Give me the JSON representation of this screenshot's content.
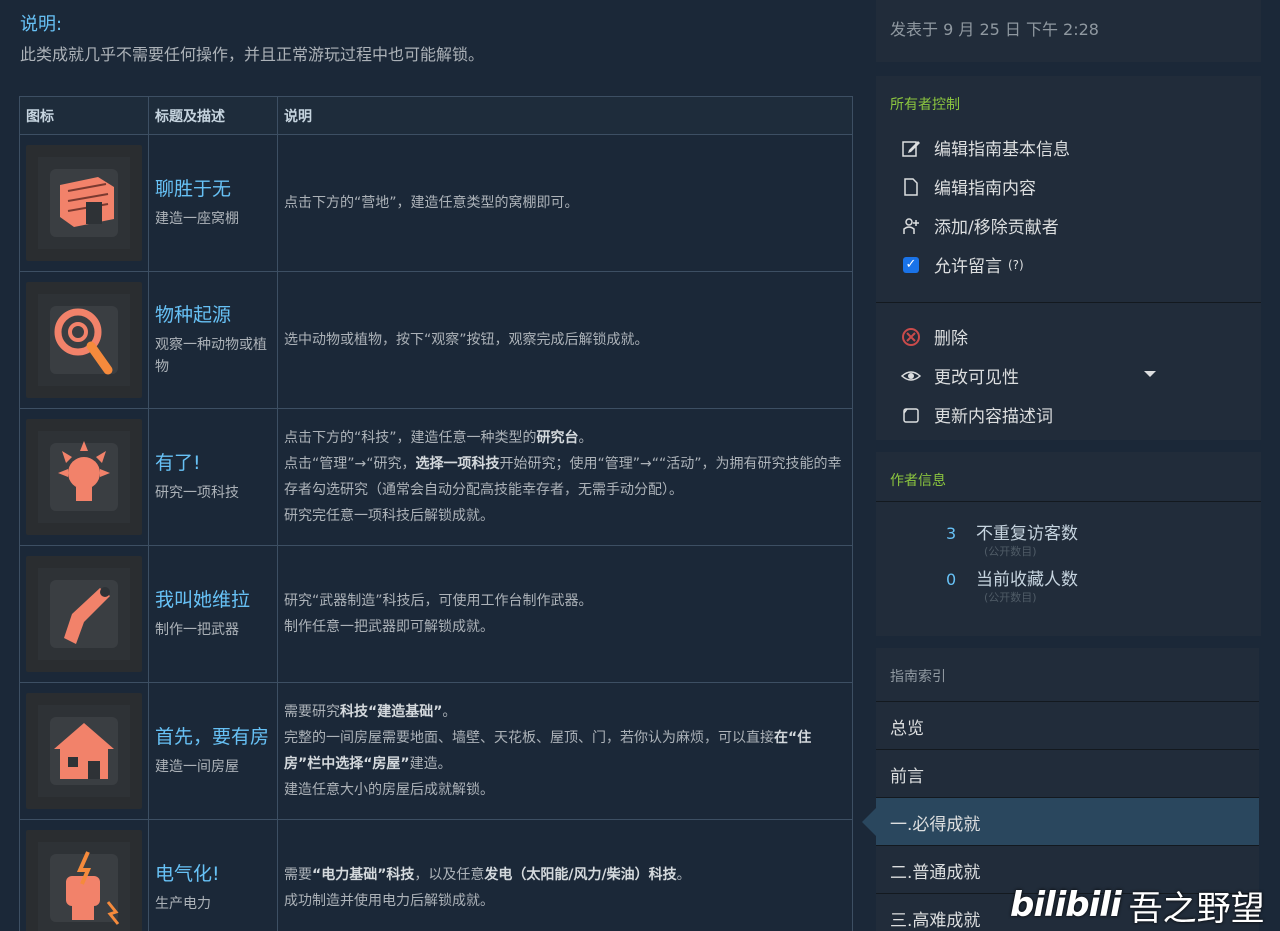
{
  "intro": {
    "title": "说明:",
    "text": "此类成就几乎不需要任何操作，并且正常游玩过程中也可能解锁。"
  },
  "table": {
    "headers": [
      "图标",
      "标题及描述",
      "说明"
    ],
    "rows": [
      {
        "name": "聊胜于无",
        "desc": "建造一座窝棚",
        "icon": "shelter-icon",
        "note": [
          "点击下方的“营地”，建造任意类型的窝棚即可。"
        ]
      },
      {
        "name": "物种起源",
        "desc": "观察一种动物或植物",
        "icon": "magnifier-icon",
        "note": [
          "选中动物或植物，按下“观察”按钮，观察完成后解锁成就。"
        ]
      },
      {
        "name": "有了!",
        "desc": "研究一项科技",
        "icon": "lightbulb-icon",
        "note_a": "点击下方的“科技”，建造任意一种类型的",
        "note_a_b": "研究台",
        "note_b": "点击“管理”→“研究，",
        "note_b_b": "选择一项科技",
        "note_b2": "开始研究；使用“管理”→““活动”，为拥有研究技能的幸存者勾选研究（通常会自动分配高技能幸存者，无需手动分配）。",
        "note_c": "研究完任意一项科技后解锁成就。"
      },
      {
        "name": "我叫她维拉",
        "desc": "制作一把武器",
        "icon": "shotgun-icon",
        "note_a": "研究“武器制造”科技后，可使用工作台制作武器。",
        "note_b": "制作任意一把武器即可解锁成就。"
      },
      {
        "name": "首先，要有房",
        "desc": "建造一间房屋",
        "icon": "house-icon",
        "note_a": "需要研究",
        "note_a_b": "科技“建造基础”",
        "note_b": "完整的一间房屋需要地面、墙壁、天花板、屋顶、门，若你认为麻烦，可以直接",
        "note_b_b": "在“住房”栏中选择“房屋”",
        "note_b2": "建造。",
        "note_c": "建造任意大小的房屋后成就解锁。"
      },
      {
        "name": "电气化!",
        "desc": "生产电力",
        "icon": "electric-fist-icon",
        "note_a": "需要",
        "note_a_b": "“电力基础”科技",
        "note_a2": "，以及任意",
        "note_a_b2": "发电（太阳能/风力/柴油）科技",
        "note_b": "成功制造并使用电力后解锁成就。"
      }
    ]
  },
  "sidebar": {
    "posted": "发表于   9 月 25 日 下午 2:28",
    "owner_title": "所有者控制",
    "owner_items": [
      {
        "label": "编辑指南基本信息",
        "icon": "edit-icon"
      },
      {
        "label": "编辑指南内容",
        "icon": "document-icon"
      },
      {
        "label": "添加/移除贡献者",
        "icon": "add-contributor-icon"
      },
      {
        "label": "允许留言",
        "extra": "(?)",
        "icon": "checkbox-icon"
      }
    ],
    "owner_items2": [
      {
        "label": "删除",
        "icon": "delete-icon"
      },
      {
        "label": "更改可见性",
        "icon": "eye-icon"
      },
      {
        "label": "更新内容描述词",
        "icon": "tag-icon"
      }
    ],
    "author_title": "作者信息",
    "stats": [
      {
        "num": "3",
        "label": "不重复访客数",
        "sub": "(公开数目)"
      },
      {
        "num": "0",
        "label": "当前收藏人数",
        "sub": "(公开数目)"
      }
    ],
    "index_title": "指南索引",
    "index_items": [
      "总览",
      "前言",
      "一.必得成就",
      "二.普通成就",
      "三.高难成就"
    ],
    "active_index": 2
  },
  "watermark": {
    "logo": "bilibili",
    "name": "吾之野望"
  },
  "colors": {
    "bg": "#1b2838",
    "link": "#67c1f5",
    "panel": "#212c3a",
    "accent_green": "#8bc53f",
    "icon_orange": "#f2826a"
  }
}
